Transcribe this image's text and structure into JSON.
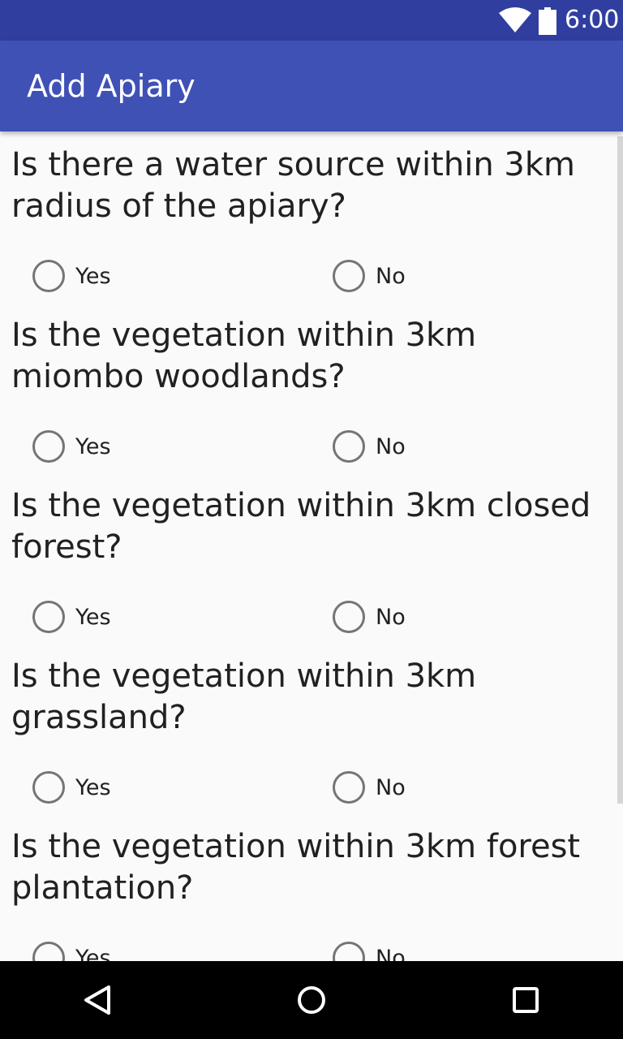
{
  "status_bar": {
    "time": "6:00",
    "icons": [
      "wifi-icon",
      "battery-icon"
    ]
  },
  "app_bar": {
    "title": "Add Apiary"
  },
  "questions": [
    {
      "text": "Is there a water source within 3km radius of the apiary?",
      "yes_label": "Yes",
      "no_label": "No",
      "selected": null
    },
    {
      "text": "Is the vegetation within 3km miombo woodlands?",
      "yes_label": "Yes",
      "no_label": "No",
      "selected": null
    },
    {
      "text": "Is the vegetation within 3km closed forest?",
      "yes_label": "Yes",
      "no_label": "No",
      "selected": null
    },
    {
      "text": "Is the vegetation within 3km grassland?",
      "yes_label": "Yes",
      "no_label": "No",
      "selected": null
    },
    {
      "text": "Is the vegetation within 3km forest plantation?",
      "yes_label": "Yes",
      "no_label": "No",
      "selected": null
    }
  ],
  "nav_bar": {
    "icons": [
      "back-icon",
      "home-icon",
      "recents-icon"
    ]
  },
  "colors": {
    "status_bar": "#303f9f",
    "app_bar": "#3f51b5",
    "background": "#fafafa",
    "text": "#212121",
    "radio_outline": "#757575"
  }
}
